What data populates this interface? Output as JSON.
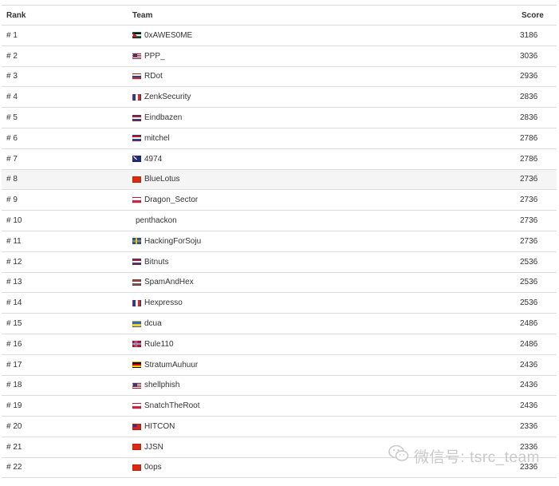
{
  "table": {
    "headers": {
      "rank": "Rank",
      "team": "Team",
      "score": "Score"
    },
    "rows": [
      {
        "rank": "# 1",
        "team": "0xAWES0ME",
        "score": "3186",
        "flag": "jo"
      },
      {
        "rank": "# 2",
        "team": "PPP_",
        "score": "3036",
        "flag": "us"
      },
      {
        "rank": "# 3",
        "team": "RDot",
        "score": "2936",
        "flag": "ru"
      },
      {
        "rank": "# 4",
        "team": "ZenkSecurity",
        "score": "2836",
        "flag": "fr"
      },
      {
        "rank": "# 5",
        "team": "Eindbazen",
        "score": "2836",
        "flag": "nl"
      },
      {
        "rank": "# 6",
        "team": "mitchel",
        "score": "2786",
        "flag": "nl"
      },
      {
        "rank": "# 7",
        "team": "4974",
        "score": "2786",
        "flag": "au"
      },
      {
        "rank": "# 8",
        "team": "BlueLotus",
        "score": "2736",
        "flag": "cn"
      },
      {
        "rank": "# 9",
        "team": "Dragon_Sector",
        "score": "2736",
        "flag": "pl"
      },
      {
        "rank": "# 10",
        "team": "penthackon",
        "score": "2736",
        "flag": "none"
      },
      {
        "rank": "# 11",
        "team": "HackingForSoju",
        "score": "2736",
        "flag": "se"
      },
      {
        "rank": "# 12",
        "team": "Bitnuts",
        "score": "2536",
        "flag": "nl"
      },
      {
        "rank": "# 13",
        "team": "SpamAndHex",
        "score": "2536",
        "flag": "hu"
      },
      {
        "rank": "# 14",
        "team": "Hexpresso",
        "score": "2536",
        "flag": "fr"
      },
      {
        "rank": "# 15",
        "team": "dcua",
        "score": "2486",
        "flag": "ua"
      },
      {
        "rank": "# 16",
        "team": "Rule110",
        "score": "2486",
        "flag": "no"
      },
      {
        "rank": "# 17",
        "team": "StratumAuhuur",
        "score": "2436",
        "flag": "de"
      },
      {
        "rank": "# 18",
        "team": "shellphish",
        "score": "2436",
        "flag": "us"
      },
      {
        "rank": "# 19",
        "team": "SnatchTheRoot",
        "score": "2436",
        "flag": "pl"
      },
      {
        "rank": "# 20",
        "team": "HITCON",
        "score": "2336",
        "flag": "tw"
      },
      {
        "rank": "# 21",
        "team": "JJSN",
        "score": "2336",
        "flag": "cn"
      },
      {
        "rank": "# 22",
        "team": "0ops",
        "score": "2336",
        "flag": "cn"
      }
    ],
    "highlighted_row": "# 8"
  },
  "watermark": {
    "text": "微信号: tsrc_team",
    "icon": "wechat-icon"
  },
  "colors": {
    "border": "#dddddd",
    "highlight": "#f5f5f5",
    "text": "#333333",
    "watermark": "#c9c9c9"
  }
}
